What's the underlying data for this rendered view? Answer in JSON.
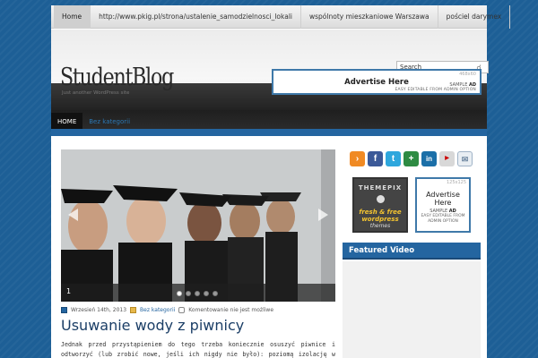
{
  "top_nav": {
    "items": [
      "Home",
      "http://www.pkig.pl/strona/ustalenie_samodzielnosci_lokali",
      "wspólnoty mieszkaniowe Warszawa",
      "pościel darymex"
    ]
  },
  "header": {
    "logo": "StudentBlog",
    "tagline": "Just another WordPress site",
    "search_placeholder": "Search",
    "search_icon": "magnifier-icon",
    "ad": {
      "size": "468x60",
      "title": "Advertise Here",
      "sample_prefix": "SAMPLE",
      "sample_bold": "AD",
      "option": "EASY EDITABLE FROM ADMIN OPTION"
    }
  },
  "main_nav": {
    "home": "HOME",
    "category": "Bez kategorii"
  },
  "slider": {
    "caption": "1",
    "active_slide": 1,
    "slide_count": 5
  },
  "post": {
    "date": "Wrzesień 14th, 2013",
    "category": "Bez kategorii",
    "comments": "Komentowanie nie jest możliwe",
    "title": "Usuwanie wody z piwnicy",
    "excerpt": "Jednak przed przystąpieniem do tego trzeba koniecznie osuszyć piwnice i odtworzyć (lub zrobić nowe, jeśli ich nigdy nie było): poziomą izolację w podłodze i pionową izolację ścian piwnic. Będzie to, niestety, dość trudne"
  },
  "sidebar": {
    "social_icons": [
      "rss-icon",
      "facebook-icon",
      "twitter-icon",
      "google-plus-icon",
      "linkedin-icon",
      "youtube-icon",
      "email-icon"
    ],
    "themepix": {
      "brand": "THEMEPIX",
      "line1": "fresh & free",
      "line2": "wordpress",
      "line3": "themes"
    },
    "ad125": {
      "size": "125x125",
      "title1": "Advertise",
      "title2": "Here",
      "sample_prefix": "SAMPLE",
      "sample_bold": "AD",
      "option1": "EASY EDITABLE FROM",
      "option2": "ADMIN OPTION"
    },
    "featured_video_title": "Featured Video"
  },
  "colors": {
    "background": "#1d5f96",
    "accent": "#2465a0",
    "post_title": "#1b3e66"
  }
}
